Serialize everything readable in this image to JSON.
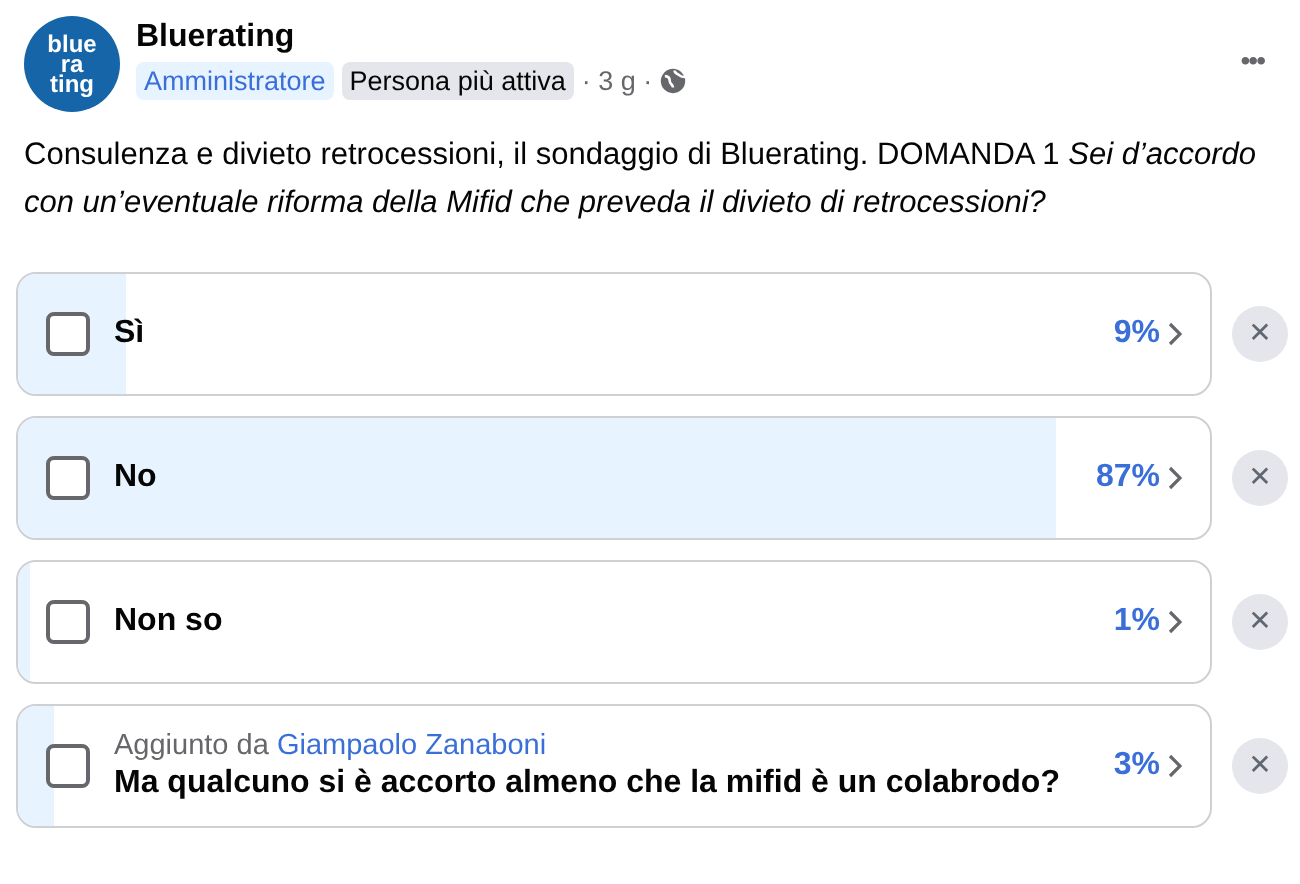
{
  "page": {
    "logo_lines": [
      "blue",
      "ra",
      "ting"
    ],
    "name": "Bluerating",
    "badges": [
      {
        "label": "Amministratore",
        "kind": "role"
      },
      {
        "label": "Persona più attiva",
        "kind": "tag"
      }
    ],
    "time": "· 3 g ·",
    "more": "•••"
  },
  "post": {
    "text": "Consulenza e divieto retrocessioni, il sondaggio di Bluerating. DOMANDA 1 *Sei d’accordo con un’eventuale riforma della Mifid che preveda il divieto di retrocessioni?*"
  },
  "options": [
    {
      "kind": "plain",
      "label": "Sì",
      "percent": "9%",
      "level": 0.09,
      "checked": false,
      "remove": "✕"
    },
    {
      "kind": "plain",
      "label": "No",
      "percent": "87%",
      "level": 0.87,
      "checked": false,
      "remove": "✕"
    },
    {
      "kind": "plain",
      "label": "Non so",
      "percent": "1%",
      "level": 0.01,
      "checked": false,
      "remove": "✕"
    },
    {
      "kind": "added",
      "added_by_prefix": "Aggiunto da",
      "added_by": "Giampaolo Zanaboni",
      "label": "Ma qualcuno si è accorto almeno che la mifid è un colabrodo?",
      "percent": "3%",
      "level": 0.03,
      "checked": false,
      "remove": "✕"
    }
  ]
}
